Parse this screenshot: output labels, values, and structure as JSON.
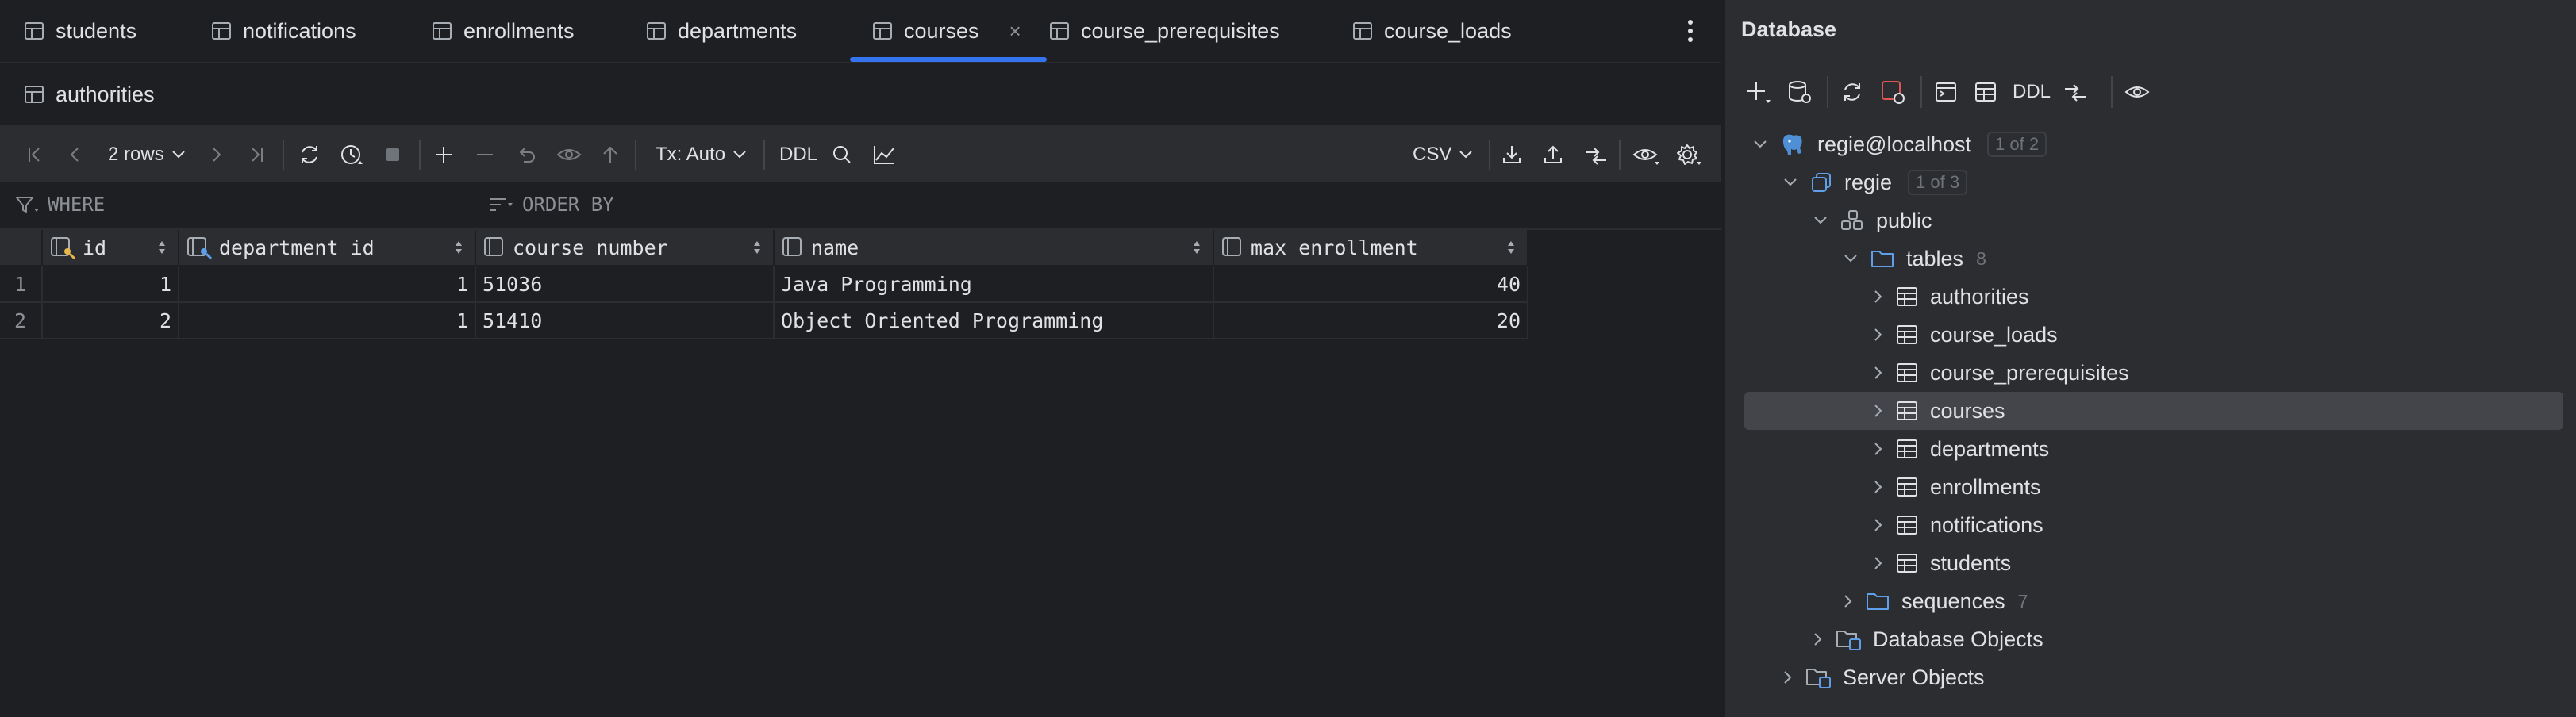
{
  "tabs": {
    "row1": [
      {
        "label": "students"
      },
      {
        "label": "notifications"
      },
      {
        "label": "enrollments"
      },
      {
        "label": "departments"
      },
      {
        "label": "courses",
        "active": true
      },
      {
        "label": "course_prerequisites"
      },
      {
        "label": "course_loads"
      }
    ],
    "row2": [
      {
        "label": "authorities"
      }
    ],
    "close_symbol": "×"
  },
  "toolbar": {
    "rows_label": "2 rows",
    "tx_label": "Tx: Auto",
    "ddl_label": "DDL",
    "export_format": "CSV"
  },
  "filter": {
    "where_label": "WHERE",
    "order_label": "ORDER BY"
  },
  "table": {
    "columns": [
      {
        "name": "id",
        "type": "key"
      },
      {
        "name": "department_id",
        "type": "foreign-key"
      },
      {
        "name": "course_number",
        "type": "column"
      },
      {
        "name": "name",
        "type": "column"
      },
      {
        "name": "max_enrollment",
        "type": "column"
      }
    ],
    "rows": [
      {
        "num": "1",
        "cells": [
          "1",
          "1",
          "51036",
          "Java Programming",
          "40"
        ]
      },
      {
        "num": "2",
        "cells": [
          "2",
          "1",
          "51410",
          "Object Oriented Programming",
          "20"
        ]
      }
    ]
  },
  "database": {
    "title": "Database",
    "toolbar_ddl": "DDL",
    "connection": {
      "label": "regie@localhost",
      "badge": "1 of 2"
    },
    "db": {
      "label": "regie",
      "badge": "1 of 3"
    },
    "schema": {
      "label": "public"
    },
    "tables_folder": {
      "label": "tables",
      "count": "8"
    },
    "tables": [
      {
        "label": "authorities"
      },
      {
        "label": "course_loads"
      },
      {
        "label": "course_prerequisites"
      },
      {
        "label": "courses",
        "selected": true
      },
      {
        "label": "departments"
      },
      {
        "label": "enrollments"
      },
      {
        "label": "notifications"
      },
      {
        "label": "students"
      }
    ],
    "sequences_folder": {
      "label": "sequences",
      "count": "7"
    },
    "database_objects": {
      "label": "Database Objects"
    },
    "server_objects": {
      "label": "Server Objects"
    }
  },
  "colors": {
    "background": "#1e1f22",
    "panel": "#2b2d30",
    "accent": "#3574f0",
    "text": "#dfe1e5",
    "muted": "#8c8f94",
    "connection_icon": "#4f8fd6",
    "stop_button": "#e05555"
  }
}
